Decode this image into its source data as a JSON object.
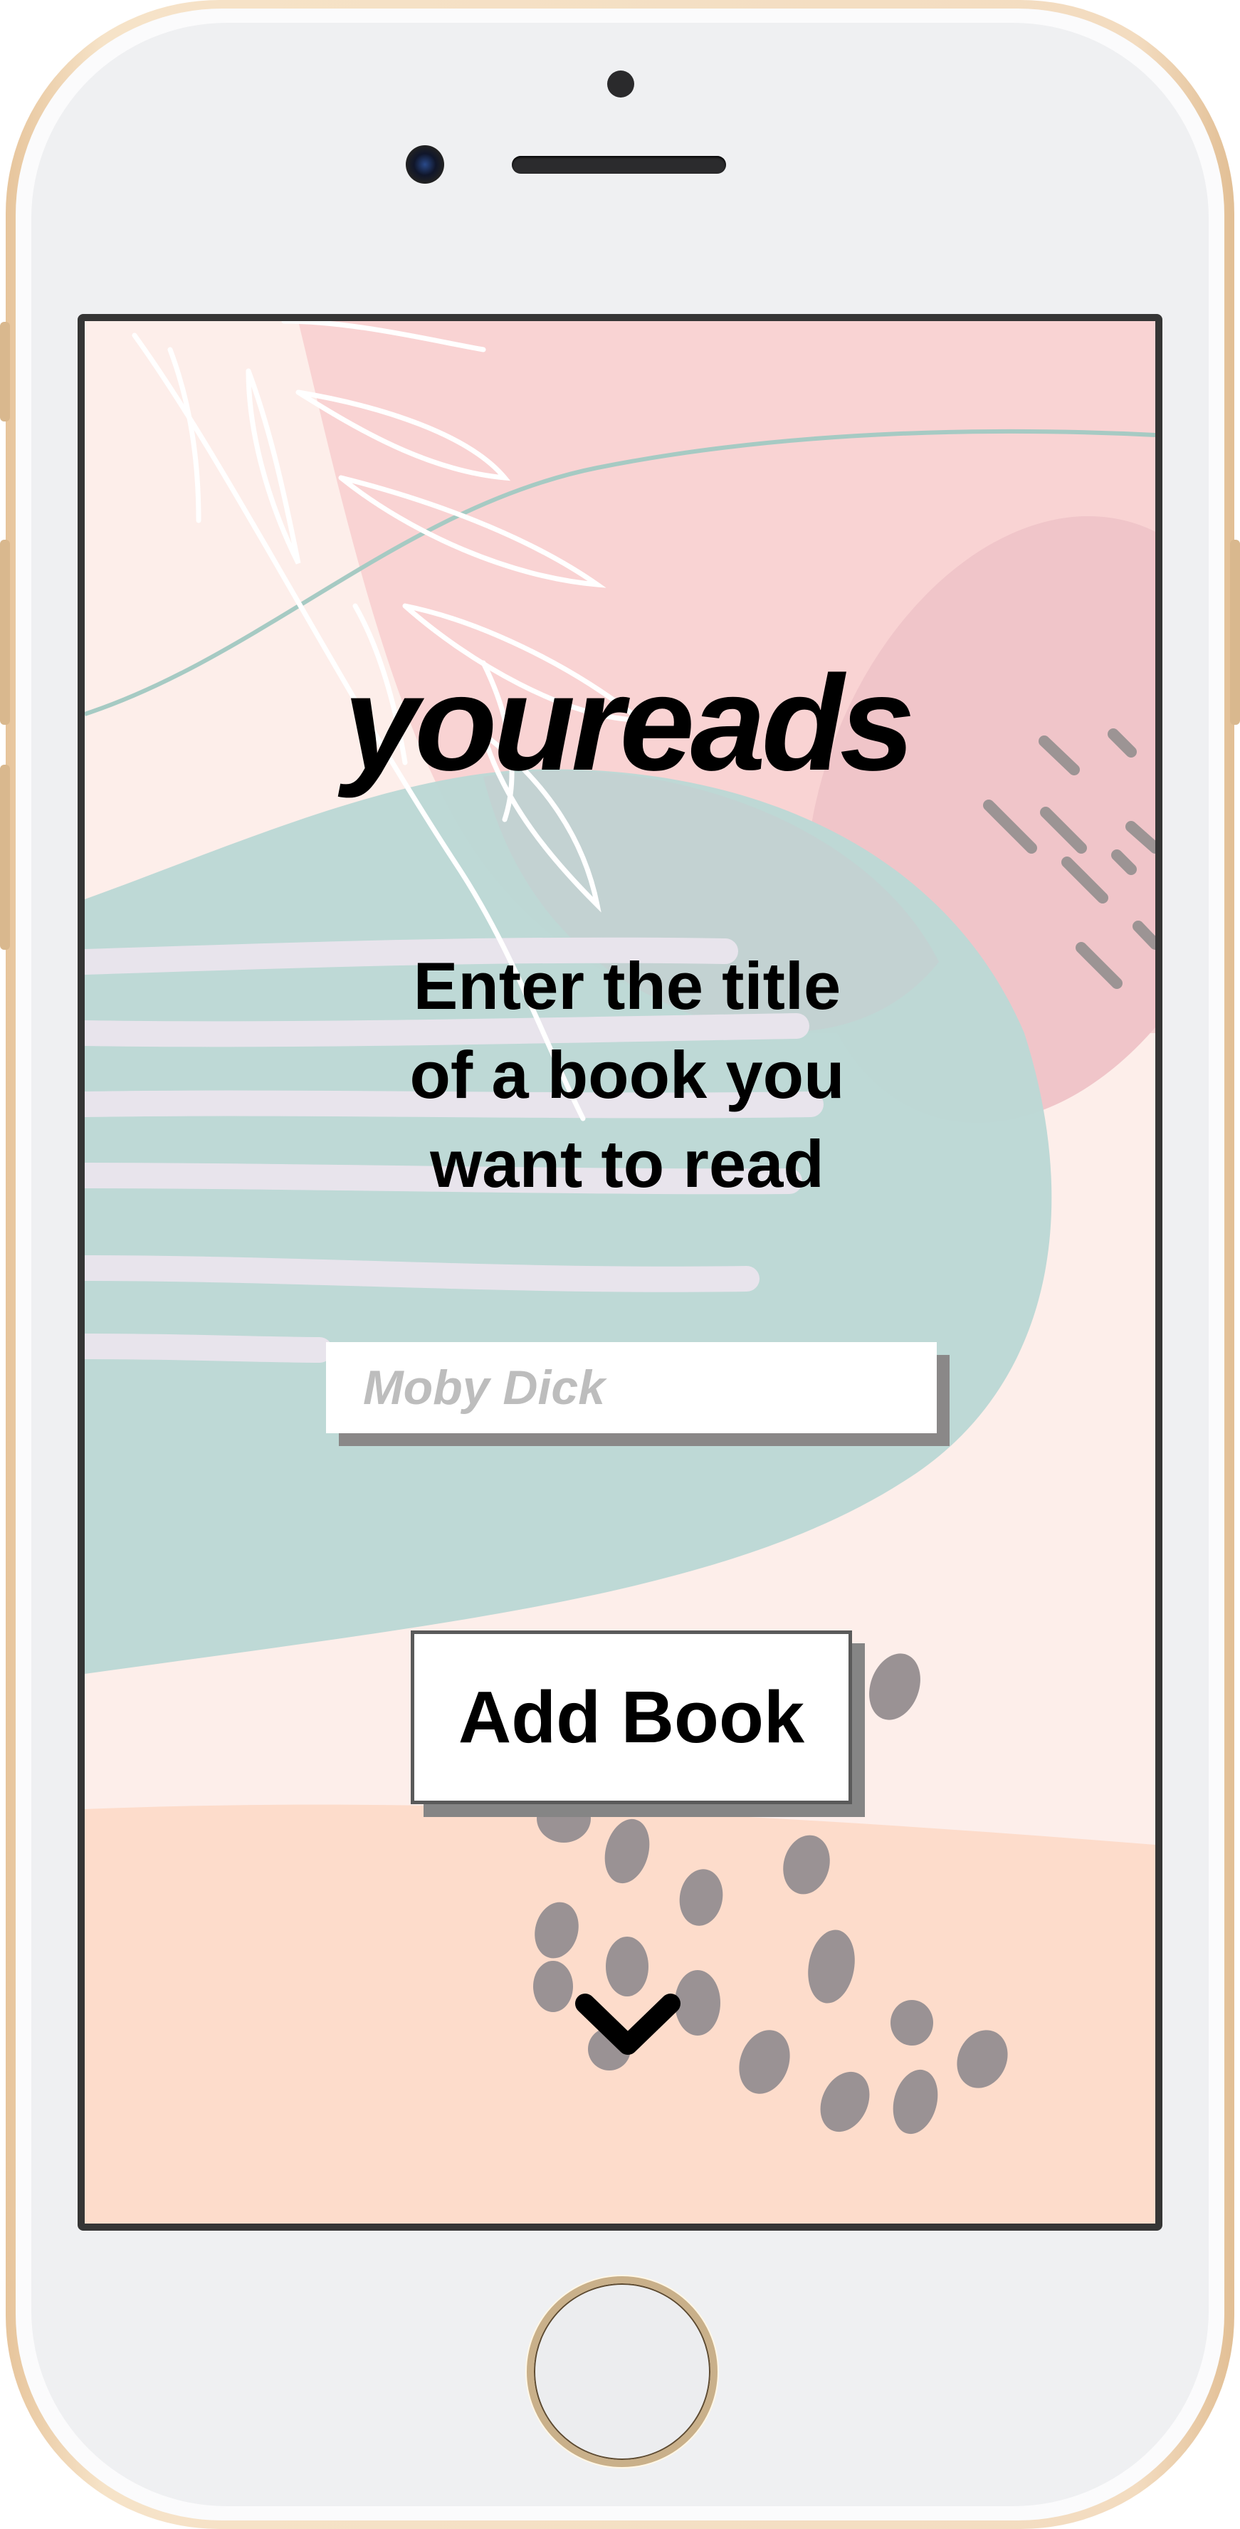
{
  "app": {
    "logo_text": "youreads",
    "prompt_lines": [
      "Enter the title",
      "of a book you",
      "want to read"
    ],
    "search": {
      "placeholder": "Moby Dick",
      "value": ""
    },
    "add_button_label": "Add Book",
    "scroll_icon": "chevron-down-icon"
  },
  "colors": {
    "pink": "#f9d3d3",
    "teal": "#bdd8d5",
    "peach": "#fddccb",
    "base": "#fdeeea",
    "dots": "#9a9294"
  }
}
